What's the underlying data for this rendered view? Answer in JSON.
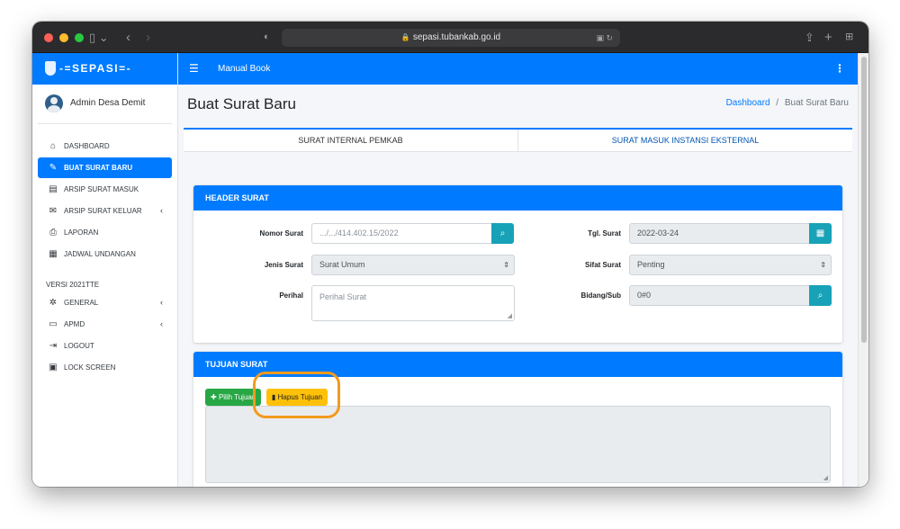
{
  "browser": {
    "url": "sepasi.tubankab.go.id"
  },
  "brand": {
    "name": "-=SEPASI=-"
  },
  "user": {
    "name": "Admin Desa Demit"
  },
  "sidebar": {
    "items": [
      {
        "label": "DASHBOARD",
        "icon": "home-icon"
      },
      {
        "label": "BUAT SURAT BARU",
        "icon": "edit-icon",
        "active": true
      },
      {
        "label": "ARSIP SURAT MASUK",
        "icon": "inbox-icon"
      },
      {
        "label": "ARSIP SURAT KELUAR",
        "icon": "mail-outbox-icon",
        "caret": "‹"
      },
      {
        "label": "LAPORAN",
        "icon": "printer-icon"
      },
      {
        "label": "JADWAL UNDANGAN",
        "icon": "calendar-icon"
      }
    ],
    "section_header": "VERSI 2021TTE",
    "items2": [
      {
        "label": "GENERAL",
        "icon": "gear-icon",
        "caret": "‹"
      },
      {
        "label": "APMD",
        "icon": "id-card-icon",
        "caret": "‹"
      },
      {
        "label": "LOGOUT",
        "icon": "logout-icon"
      },
      {
        "label": "LOCK SCREEN",
        "icon": "lock-icon"
      }
    ]
  },
  "topbar": {
    "manual_label": "Manual Book"
  },
  "page": {
    "title": "Buat Surat Baru",
    "breadcrumb_home": "Dashboard",
    "breadcrumb_sep": "/",
    "breadcrumb_current": "Buat Surat Baru"
  },
  "tabs": [
    {
      "label": "SURAT INTERNAL PEMKAB",
      "active": true
    },
    {
      "label": "SURAT MASUK INSTANSI EKSTERNAL",
      "active": false
    }
  ],
  "header_surat": {
    "title": "HEADER SURAT",
    "nomor_label": "Nomor Surat",
    "nomor_placeholder": ".../.../414.402.15/2022",
    "tgl_label": "Tgl. Surat",
    "tgl_value": "2022-03-24",
    "jenis_label": "Jenis Surat",
    "jenis_value": "Surat Umum",
    "sifat_label": "Sifat Surat",
    "sifat_value": "Penting",
    "perihal_label": "Perihal",
    "perihal_placeholder": "Perihal Surat",
    "bidang_label": "Bidang/Sub",
    "bidang_value": "0#0"
  },
  "tujuan_surat": {
    "title": "TUJUAN SURAT",
    "pilih_label": "Pilih Tujuan",
    "hapus_label": "Hapus Tujuan"
  },
  "colors": {
    "primary": "#007bff",
    "info": "#17a2b8",
    "success": "#28a745",
    "warning": "#ffc107",
    "highlight": "#f39a1d"
  }
}
